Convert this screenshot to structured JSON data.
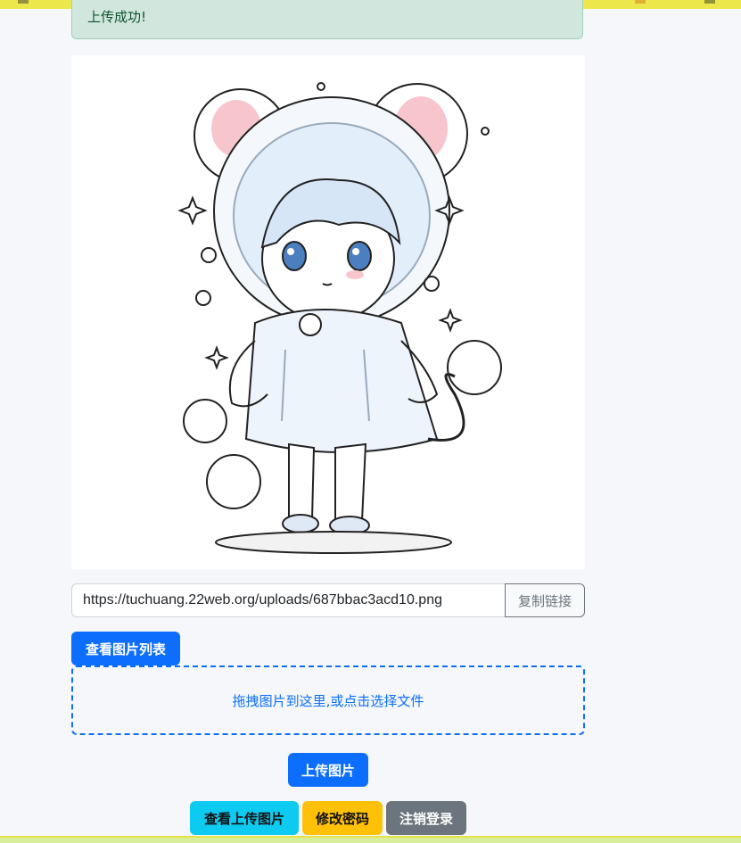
{
  "alert": {
    "message": "上传成功!"
  },
  "preview": {
    "alt": "uploaded image preview"
  },
  "link": {
    "value": "https://tuchuang.22web.org/uploads/687bbac3acd10.png",
    "copy_label": "复制链接"
  },
  "buttons": {
    "view_list": "查看图片列表",
    "upload": "上传图片",
    "view_uploaded": "查看上传图片",
    "change_password": "修改密码",
    "logout": "注销登录"
  },
  "dropzone": {
    "text": "拖拽图片到这里,或点击选择文件"
  },
  "colors": {
    "primary": "#0d6efd",
    "info": "#0dcaf0",
    "warning": "#ffc107",
    "secondary": "#6c757d",
    "success_bg": "#d1e7dd"
  }
}
